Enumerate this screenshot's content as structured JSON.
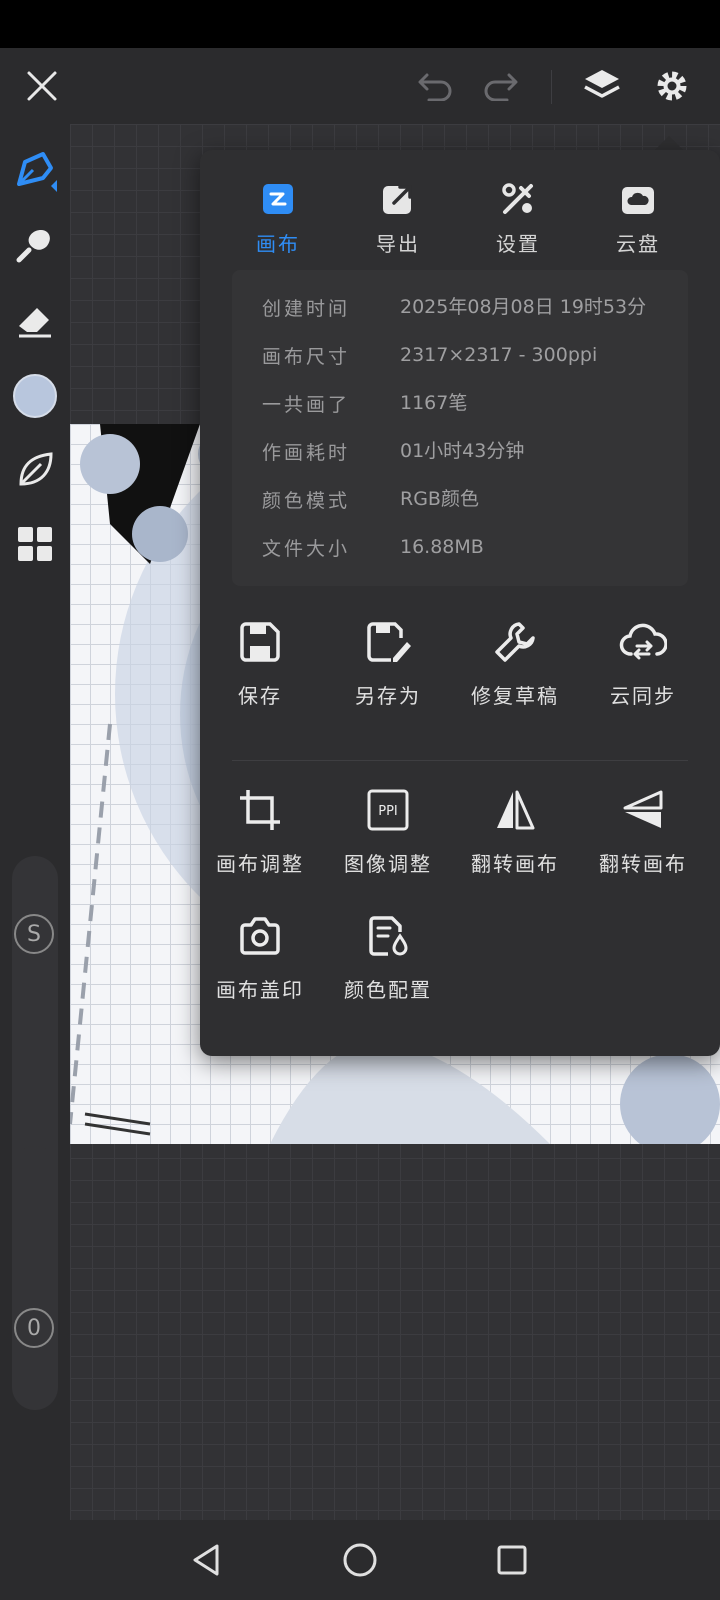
{
  "topbar": {
    "icons": [
      "close-icon",
      "undo-icon",
      "redo-icon",
      "layers-icon",
      "gear-icon"
    ]
  },
  "sidebar": {
    "tools": [
      "pen-tool-icon",
      "smudge-tool-icon",
      "eraser-icon",
      "color-swatch",
      "leaf-icon",
      "grid-apps-icon"
    ],
    "color": "#b8c6dd",
    "size_knob": "S",
    "opacity_knob": "0"
  },
  "panel": {
    "tabs": [
      {
        "label": "画布",
        "icon": "canvas-tab-icon",
        "active": true
      },
      {
        "label": "导出",
        "icon": "export-icon",
        "active": false
      },
      {
        "label": "设置",
        "icon": "settings-tools-icon",
        "active": false
      },
      {
        "label": "云盘",
        "icon": "cloud-drive-icon",
        "active": false
      }
    ],
    "info": [
      {
        "key": "创建时间",
        "value": "2025年08月08日 19时53分"
      },
      {
        "key": "画布尺寸",
        "value": "2317×2317 - 300ppi"
      },
      {
        "key": "一共画了",
        "value": "1167笔"
      },
      {
        "key": "作画耗时",
        "value": "01小时43分钟"
      },
      {
        "key": "颜色模式",
        "value": "RGB颜色"
      },
      {
        "key": "文件大小",
        "value": "16.88MB"
      }
    ],
    "actions_row1": [
      {
        "label": "保存",
        "icon": "save-icon"
      },
      {
        "label": "另存为",
        "icon": "save-as-icon"
      },
      {
        "label": "修复草稿",
        "icon": "repair-wrench-icon"
      },
      {
        "label": "云同步",
        "icon": "cloud-sync-icon"
      }
    ],
    "actions_row2": [
      {
        "label": "画布调整",
        "icon": "crop-icon"
      },
      {
        "label": "图像调整",
        "icon": "ppi-icon"
      },
      {
        "label": "翻转画布",
        "icon": "flip-horizontal-icon"
      },
      {
        "label": "翻转画布",
        "icon": "flip-vertical-icon"
      }
    ],
    "actions_row3": [
      {
        "label": "画布盖印",
        "icon": "camera-stamp-icon"
      },
      {
        "label": "颜色配置",
        "icon": "color-profile-icon"
      }
    ]
  },
  "colors": {
    "accent": "#2f8df5",
    "panel_bg": "#2f2f31"
  }
}
